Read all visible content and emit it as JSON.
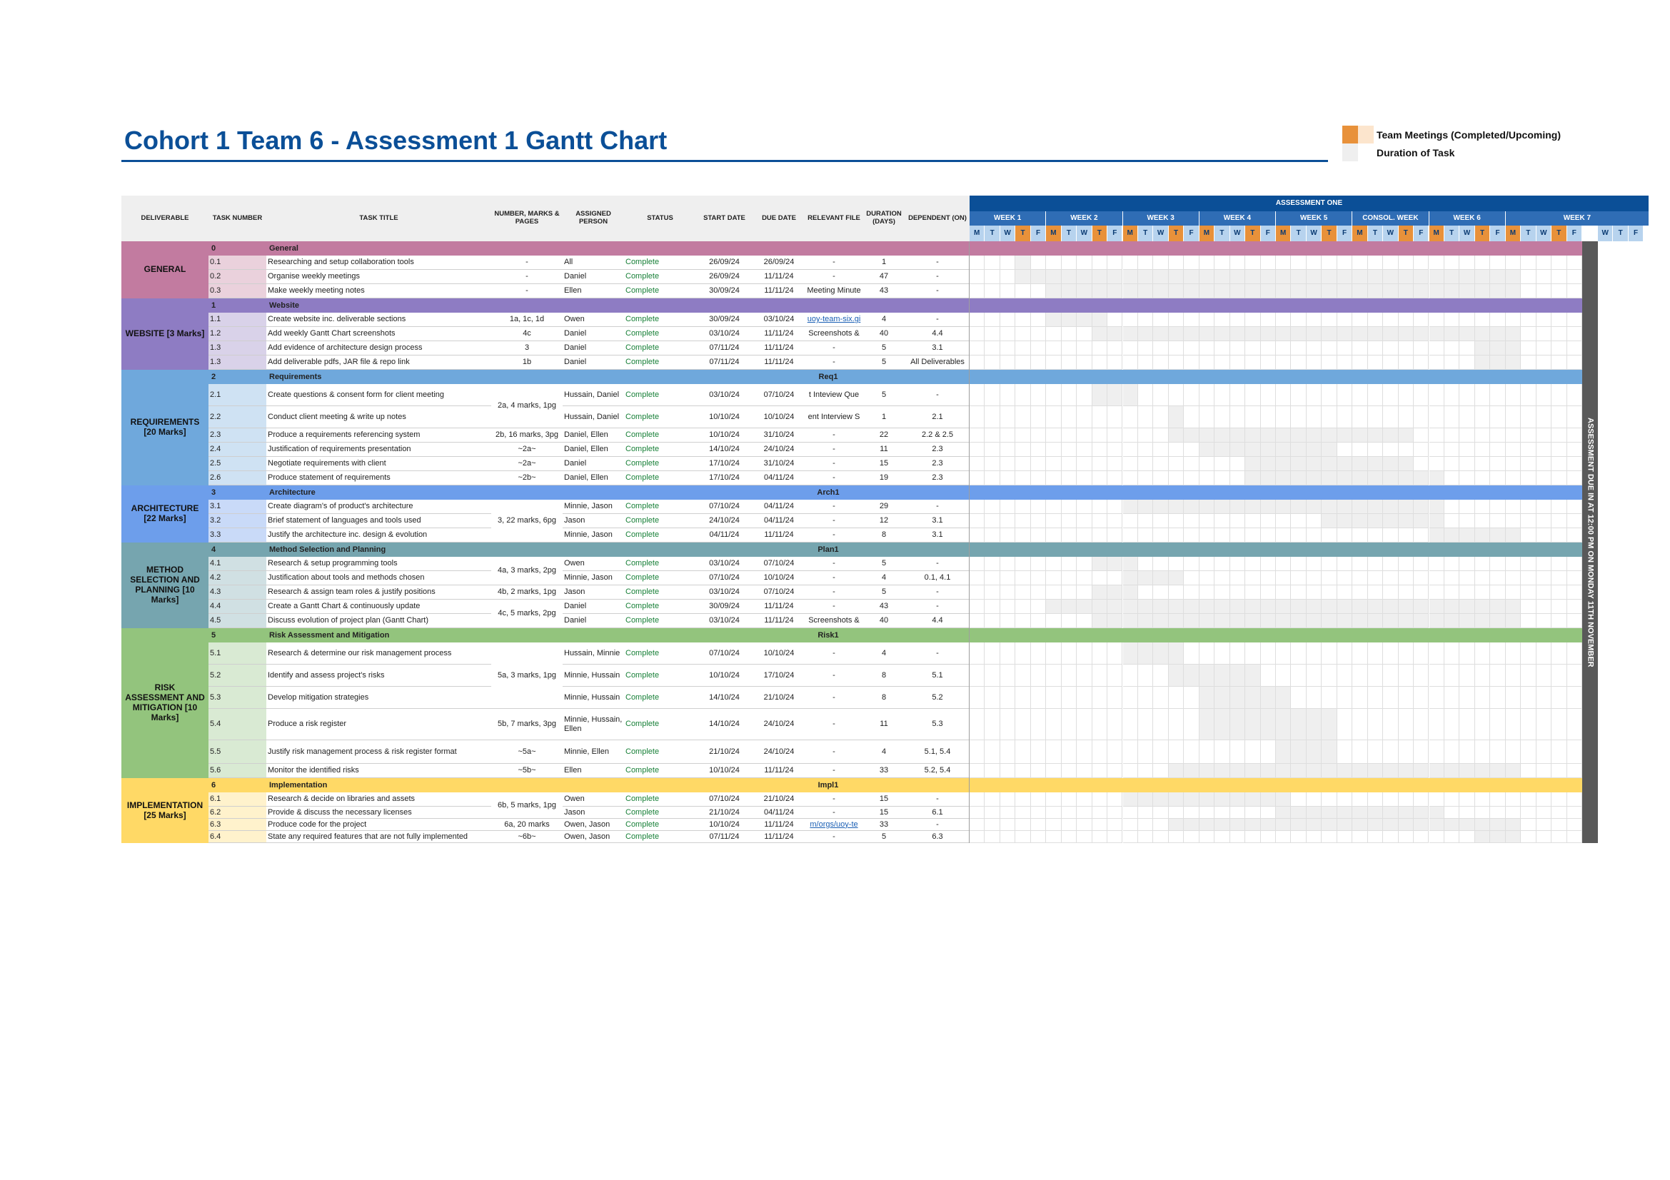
{
  "title": "Cohort 1 Team 6 - Assessment 1 Gantt Chart",
  "legend": [
    {
      "label": "Team Meetings (Completed/Upcoming)",
      "colors": [
        "#e8913a",
        "#fce5cd"
      ]
    },
    {
      "label": "Duration of Task",
      "colors": [
        "#efefef"
      ]
    }
  ],
  "headers": {
    "deliverable": "DELIVERABLE",
    "task_number": "TASK NUMBER",
    "task_title": "TASK TITLE",
    "marks": "NUMBER, MARKS & PAGES",
    "person": "ASSIGNED PERSON",
    "status": "STATUS",
    "start": "START DATE",
    "due": "DUE DATE",
    "file": "RELEVANT FILE",
    "duration": "DURATION (DAYS)",
    "dependent": "DEPENDENT (ON)"
  },
  "timeline": {
    "assessment_label": "ASSESSMENT ONE",
    "weeks": [
      "WEEK 1",
      "WEEK 2",
      "WEEK 3",
      "WEEK 4",
      "WEEK 5",
      "CONSOL. WEEK",
      "WEEK 6",
      "WEEK 7"
    ],
    "day_letters": [
      "M",
      "T",
      "W",
      "T",
      "F"
    ],
    "due_banner": "ASSESSMENT DUE IN AT 12:00 PM ON MONDAY 11TH NOVEMBER"
  },
  "colors": {
    "header_bg": "#efefef",
    "week_bg": "#2f6db5",
    "assessment_bg": "#0b4f97",
    "day_bg": "#b7d3ee",
    "meeting_done": "#e8913a",
    "meeting_upcoming": "#fce5cd",
    "task_bar": "#efefef",
    "due_bar": "#595959",
    "status_complete": "#188038"
  },
  "sections": [
    {
      "deliverable": "GENERAL",
      "num": "0",
      "name": "General",
      "code": "",
      "color": "#c27ba0",
      "light": "#ead1dc",
      "tasks": [
        {
          "num": "0.1",
          "title": "Researching and setup collaboration tools",
          "marks": "-",
          "person": "All",
          "status": "Complete",
          "start": "26/09/24",
          "due": "26/09/24",
          "file": "-",
          "duration": "1",
          "dep": "-"
        },
        {
          "num": "0.2",
          "title": "Organise weekly meetings",
          "marks": "-",
          "person": "Daniel",
          "status": "Complete",
          "start": "26/09/24",
          "due": "11/11/24",
          "file": "-",
          "duration": "47",
          "dep": "-"
        },
        {
          "num": "0.3",
          "title": "Make weekly meeting notes",
          "marks": "-",
          "person": "Ellen",
          "status": "Complete",
          "start": "30/09/24",
          "due": "11/11/24",
          "file": "Meeting Minute",
          "duration": "43",
          "dep": "-"
        }
      ]
    },
    {
      "deliverable": "WEBSITE [3 Marks]",
      "num": "1",
      "name": "Website",
      "code": "",
      "color": "#8e7cc3",
      "light": "#d9d2e9",
      "tasks": [
        {
          "num": "1.1",
          "title": "Create website inc. deliverable sections",
          "marks": "1a, 1c, 1d",
          "person": "Owen",
          "status": "Complete",
          "start": "30/09/24",
          "due": "03/10/24",
          "file": "uoy-team-six.gi",
          "link": true,
          "duration": "4",
          "dep": "-"
        },
        {
          "num": "1.2",
          "title": "Add weekly Gantt Chart screenshots",
          "marks": "4c",
          "person": "Daniel",
          "status": "Complete",
          "start": "03/10/24",
          "due": "11/11/24",
          "file": "Screenshots &",
          "duration": "40",
          "dep": "4.4"
        },
        {
          "num": "1.3",
          "title": "Add evidence of architecture design process",
          "marks": "3",
          "person": "Daniel",
          "status": "Complete",
          "start": "07/11/24",
          "due": "11/11/24",
          "file": "-",
          "duration": "5",
          "dep": "3.1"
        },
        {
          "num": "1.3",
          "title": "Add deliverable pdfs, JAR file & repo link",
          "marks": "1b",
          "person": "Daniel",
          "status": "Complete",
          "start": "07/11/24",
          "due": "11/11/24",
          "file": "-",
          "duration": "5",
          "dep": "All Deliverables"
        }
      ]
    },
    {
      "deliverable": "REQUIREMENTS [20 Marks]",
      "num": "2",
      "name": "Requirements",
      "code": "Req1",
      "color": "#6fa8dc",
      "light": "#cfe2f3",
      "merged_marks": [
        {
          "text": "2a, 4 marks, 1pg",
          "rows": [
            0,
            1
          ]
        }
      ],
      "tasks": [
        {
          "num": "2.1",
          "title": "Create questions & consent form for client meeting",
          "marks": "",
          "person": "Hussain, Daniel",
          "status": "Complete",
          "start": "03/10/24",
          "due": "07/10/24",
          "file": "t Inteview Que",
          "duration": "5",
          "dep": "-"
        },
        {
          "num": "2.2",
          "title": "Conduct client meeting & write up notes",
          "marks": "",
          "person": "Hussain, Daniel",
          "status": "Complete",
          "start": "10/10/24",
          "due": "10/10/24",
          "file": "ent Interview S",
          "duration": "1",
          "dep": "2.1"
        },
        {
          "num": "2.3",
          "title": "Produce a requirements referencing system",
          "marks": "2b, 16 marks, 3pg",
          "person": "Daniel, Ellen",
          "status": "Complete",
          "start": "10/10/24",
          "due": "31/10/24",
          "file": "-",
          "duration": "22",
          "dep": "2.2 & 2.5"
        },
        {
          "num": "2.4",
          "title": "Justification of requirements presentation",
          "marks": "~2a~",
          "person": "Daniel, Ellen",
          "status": "Complete",
          "start": "14/10/24",
          "due": "24/10/24",
          "file": "-",
          "duration": "11",
          "dep": "2.3"
        },
        {
          "num": "2.5",
          "title": "Negotiate requirements with client",
          "marks": "~2a~",
          "person": "Daniel",
          "status": "Complete",
          "start": "17/10/24",
          "due": "31/10/24",
          "file": "-",
          "duration": "15",
          "dep": "2.3"
        },
        {
          "num": "2.6",
          "title": "Produce statement of requirements",
          "marks": "~2b~",
          "person": "Daniel, Ellen",
          "status": "Complete",
          "start": "17/10/24",
          "due": "04/11/24",
          "file": "-",
          "duration": "19",
          "dep": "2.3"
        }
      ]
    },
    {
      "deliverable": "ARCHITECTURE [22 Marks]",
      "num": "3",
      "name": "Architecture",
      "code": "Arch1",
      "color": "#6d9eeb",
      "light": "#c9daf8",
      "merged_marks": [
        {
          "text": "3, 22 marks, 6pg",
          "rows": [
            0,
            2
          ]
        }
      ],
      "tasks": [
        {
          "num": "3.1",
          "title": "Create diagram's of product's architecture",
          "marks": "",
          "person": "Minnie, Jason",
          "status": "Complete",
          "start": "07/10/24",
          "due": "04/11/24",
          "file": "-",
          "duration": "29",
          "dep": "-"
        },
        {
          "num": "3.2",
          "title": "Brief statement of languages and tools used",
          "marks": "",
          "person": "Jason",
          "status": "Complete",
          "start": "24/10/24",
          "due": "04/11/24",
          "file": "-",
          "duration": "12",
          "dep": "3.1"
        },
        {
          "num": "3.3",
          "title": "Justify the architecture inc. design & evolution",
          "marks": "",
          "person": "Minnie, Jason",
          "status": "Complete",
          "start": "04/11/24",
          "due": "11/11/24",
          "file": "-",
          "duration": "8",
          "dep": "3.1"
        }
      ]
    },
    {
      "deliverable": "METHOD SELECTION AND PLANNING [10 Marks]",
      "num": "4",
      "name": "Method Selection and Planning",
      "code": "Plan1",
      "color": "#76a5af",
      "light": "#d0e0e3",
      "merged_marks": [
        {
          "text": "4a, 3 marks, 2pg",
          "rows": [
            0,
            1
          ]
        },
        {
          "text": "4c, 5 marks, 2pg",
          "rows": [
            3,
            4
          ]
        }
      ],
      "tasks": [
        {
          "num": "4.1",
          "title": "Research & setup programming tools",
          "marks": "",
          "person": "Owen",
          "status": "Complete",
          "start": "03/10/24",
          "due": "07/10/24",
          "file": "-",
          "duration": "5",
          "dep": "-"
        },
        {
          "num": "4.2",
          "title": "Justification about tools and methods chosen",
          "marks": "",
          "person": "Minnie, Jason",
          "status": "Complete",
          "start": "07/10/24",
          "due": "10/10/24",
          "file": "-",
          "duration": "4",
          "dep": "0.1, 4.1"
        },
        {
          "num": "4.3",
          "title": "Research & assign team roles & justify positions",
          "marks": "4b, 2 marks, 1pg",
          "person": "Jason",
          "status": "Complete",
          "start": "03/10/24",
          "due": "07/10/24",
          "file": "-",
          "duration": "5",
          "dep": "-"
        },
        {
          "num": "4.4",
          "title": "Create a Gantt Chart & continuously update",
          "marks": "",
          "person": "Daniel",
          "status": "Complete",
          "start": "30/09/24",
          "due": "11/11/24",
          "file": "-",
          "duration": "43",
          "dep": "-"
        },
        {
          "num": "4.5",
          "title": "Discuss evolution of project plan (Gantt Chart)",
          "marks": "",
          "person": "Daniel",
          "status": "Complete",
          "start": "03/10/24",
          "due": "11/11/24",
          "file": "Screenshots &",
          "duration": "40",
          "dep": "4.4"
        }
      ]
    },
    {
      "deliverable": "RISK ASSESSMENT AND MITIGATION [10 Marks]",
      "num": "5",
      "name": "Risk Assessment and Mitigation",
      "code": "Risk1",
      "color": "#93c47d",
      "light": "#d9ead3",
      "merged_marks": [
        {
          "text": "5a, 3 marks, 1pg",
          "rows": [
            0,
            2
          ]
        }
      ],
      "tasks": [
        {
          "num": "5.1",
          "title": "Research & determine our risk management process",
          "marks": "",
          "person": "Hussain, Minnie",
          "status": "Complete",
          "start": "07/10/24",
          "due": "10/10/24",
          "file": "-",
          "duration": "4",
          "dep": "-"
        },
        {
          "num": "5.2",
          "title": "Identify and assess project's risks",
          "marks": "",
          "person": "Minnie, Hussain",
          "status": "Complete",
          "start": "10/10/24",
          "due": "17/10/24",
          "file": "-",
          "duration": "8",
          "dep": "5.1"
        },
        {
          "num": "5.3",
          "title": "Develop mitigation strategies",
          "marks": "",
          "person": "Minnie, Hussain",
          "status": "Complete",
          "start": "14/10/24",
          "due": "21/10/24",
          "file": "-",
          "duration": "8",
          "dep": "5.2"
        },
        {
          "num": "5.4",
          "title": "Produce a risk register",
          "marks": "5b, 7 marks, 3pg",
          "person": "Minnie, Hussain, Ellen",
          "status": "Complete",
          "start": "14/10/24",
          "due": "24/10/24",
          "file": "-",
          "duration": "11",
          "dep": "5.3"
        },
        {
          "num": "5.5",
          "title": "Justify risk management process & risk register format",
          "marks": "~5a~",
          "person": "Minnie, Ellen",
          "status": "Complete",
          "start": "21/10/24",
          "due": "24/10/24",
          "file": "-",
          "duration": "4",
          "dep": "5.1, 5.4"
        },
        {
          "num": "5.6",
          "title": "Monitor the identified risks",
          "marks": "~5b~",
          "person": "Ellen",
          "status": "Complete",
          "start": "10/10/24",
          "due": "11/11/24",
          "file": "-",
          "duration": "33",
          "dep": "5.2, 5.4"
        }
      ]
    },
    {
      "deliverable": "IMPLEMENTATION [25 Marks]",
      "num": "6",
      "name": "Implementation",
      "code": "Impl1",
      "color": "#ffd966",
      "light": "#fff2cc",
      "merged_marks": [
        {
          "text": "6b, 5 marks, 1pg",
          "rows": [
            0,
            1
          ]
        }
      ],
      "tasks": [
        {
          "num": "6.1",
          "title": "Research & decide on libraries and assets",
          "marks": "",
          "person": "Owen",
          "status": "Complete",
          "start": "07/10/24",
          "due": "21/10/24",
          "file": "-",
          "duration": "15",
          "dep": "-"
        },
        {
          "num": "6.2",
          "title": "Provide & discuss the necessary licenses",
          "marks": "",
          "person": "Jason",
          "status": "Complete",
          "start": "21/10/24",
          "due": "04/11/24",
          "file": "-",
          "duration": "15",
          "dep": "6.1"
        },
        {
          "num": "6.3",
          "title": "Produce code for the project",
          "marks": "6a, 20 marks",
          "person": "Owen, Jason",
          "status": "Complete",
          "start": "10/10/24",
          "due": "11/11/24",
          "file": "m/orgs/uoy-te",
          "link": true,
          "duration": "33",
          "dep": "-"
        },
        {
          "num": "6.4",
          "title": "State any required features that are not fully implemented",
          "marks": "~6b~",
          "person": "Owen, Jason",
          "status": "Complete",
          "start": "07/11/24",
          "due": "11/11/24",
          "file": "-",
          "duration": "5",
          "dep": "6.3"
        }
      ]
    }
  ]
}
